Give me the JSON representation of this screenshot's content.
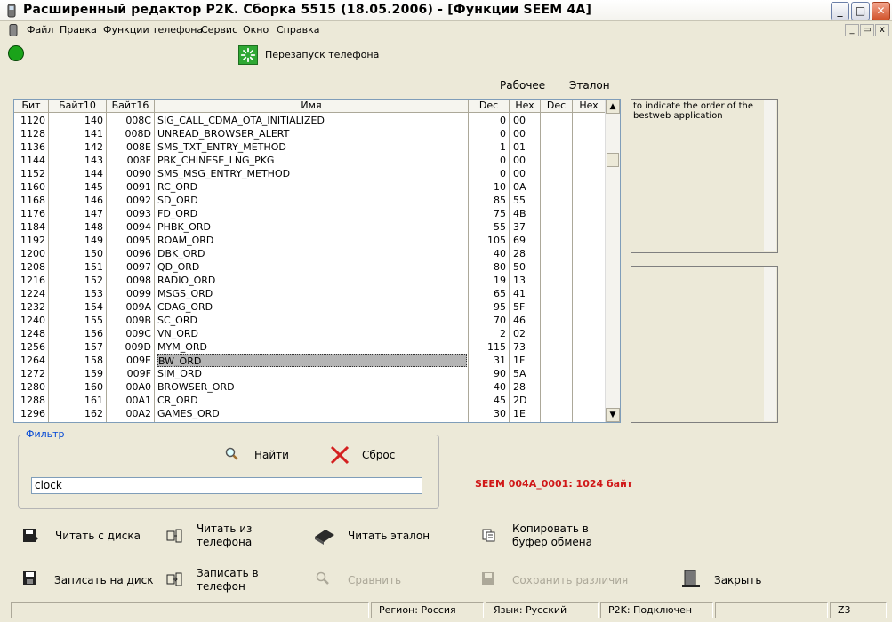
{
  "window": {
    "title": "Расширенный редактор P2K. Сборка 5515 (18.05.2006) - [Функции SEEM 4A]",
    "minimize_glyph": "_",
    "maximize_glyph": "□",
    "close_glyph": "✕"
  },
  "menu": [
    "Файл",
    "Правка",
    "Функции телефона",
    "Сервис",
    "Окно",
    "Справка"
  ],
  "mdi_buttons": [
    "_",
    "▭",
    "x"
  ],
  "toolbar": {
    "restart_label": "Перезапуск телефона",
    "status_color": "#1aa31a"
  },
  "group_headers": {
    "working": "Рабочее",
    "reference": "Эталон"
  },
  "table": {
    "columns": [
      "Бит",
      "Байт10",
      "Байт16",
      "Имя",
      "Dec",
      "Hex",
      "Dec",
      "Hex"
    ],
    "rows": [
      [
        "1120",
        "140",
        "008C",
        "SIG_CALL_CDMA_OTA_INITIALIZED",
        "0",
        "00"
      ],
      [
        "1128",
        "141",
        "008D",
        "UNREAD_BROWSER_ALERT",
        "0",
        "00"
      ],
      [
        "1136",
        "142",
        "008E",
        "SMS_TXT_ENTRY_METHOD",
        "1",
        "01"
      ],
      [
        "1144",
        "143",
        "008F",
        "PBK_CHINESE_LNG_PKG",
        "0",
        "00"
      ],
      [
        "1152",
        "144",
        "0090",
        "SMS_MSG_ENTRY_METHOD",
        "0",
        "00"
      ],
      [
        "1160",
        "145",
        "0091",
        "RC_ORD",
        "10",
        "0A"
      ],
      [
        "1168",
        "146",
        "0092",
        "SD_ORD",
        "85",
        "55"
      ],
      [
        "1176",
        "147",
        "0093",
        "FD_ORD",
        "75",
        "4B"
      ],
      [
        "1184",
        "148",
        "0094",
        "PHBK_ORD",
        "55",
        "37"
      ],
      [
        "1192",
        "149",
        "0095",
        "ROAM_ORD",
        "105",
        "69"
      ],
      [
        "1200",
        "150",
        "0096",
        "DBK_ORD",
        "40",
        "28"
      ],
      [
        "1208",
        "151",
        "0097",
        "QD_ORD",
        "80",
        "50"
      ],
      [
        "1216",
        "152",
        "0098",
        "RADIO_ORD",
        "19",
        "13"
      ],
      [
        "1224",
        "153",
        "0099",
        "MSGS_ORD",
        "65",
        "41"
      ],
      [
        "1232",
        "154",
        "009A",
        "CDAG_ORD",
        "95",
        "5F"
      ],
      [
        "1240",
        "155",
        "009B",
        "SC_ORD",
        "70",
        "46"
      ],
      [
        "1248",
        "156",
        "009C",
        "VN_ORD",
        "2",
        "02"
      ],
      [
        "1256",
        "157",
        "009D",
        "MYM_ORD",
        "115",
        "73"
      ],
      [
        "1264",
        "158",
        "009E",
        "BW_ORD",
        "31",
        "1F"
      ],
      [
        "1272",
        "159",
        "009F",
        "SIM_ORD",
        "90",
        "5A"
      ],
      [
        "1280",
        "160",
        "00A0",
        "BROWSER_ORD",
        "40",
        "28"
      ],
      [
        "1288",
        "161",
        "00A1",
        "CR_ORD",
        "45",
        "2D"
      ],
      [
        "1296",
        "162",
        "00A2",
        "GAMES_ORD",
        "30",
        "1E"
      ]
    ],
    "selected_index": 18
  },
  "description": "to indicate the order of the bestweb application",
  "filter": {
    "legend": "Фильтр",
    "find_label": "Найти",
    "reset_label": "Сброс",
    "value": "clock"
  },
  "seem_info": "SEEM 004A_0001: 1024 байт",
  "actions": {
    "read_disk": "Читать с диска",
    "read_phone": [
      "Читать из",
      "телефона"
    ],
    "read_reference": "Читать эталон",
    "copy_clipboard": [
      "Копировать в",
      "буфер обмена"
    ],
    "write_disk": "Записать на диск",
    "write_phone": [
      "Записать в",
      "телефон"
    ],
    "compare": "Сравнить",
    "save_diff": "Сохранить различия",
    "close": "Закрыть"
  },
  "statusbar": {
    "region": "Регион: Россия",
    "language": "Язык: Русский",
    "p2k": "P2K: Подключен",
    "mode": "Z3"
  }
}
